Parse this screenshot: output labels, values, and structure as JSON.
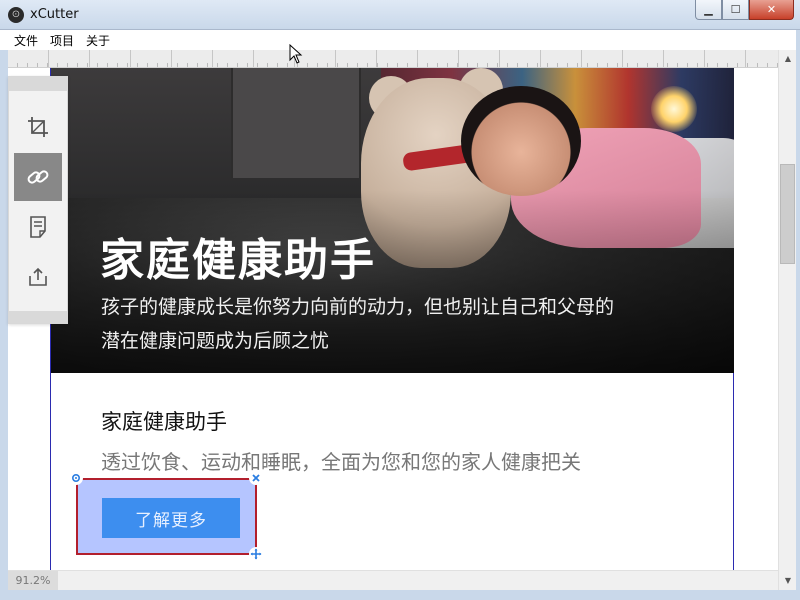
{
  "window": {
    "title": "xCutter",
    "app_icon_glyph": "⊙",
    "controls": {
      "minimize": "▁",
      "maximize": "☐",
      "close": "✕"
    }
  },
  "menu": {
    "items": [
      "文件",
      "项目",
      "关于"
    ]
  },
  "toolbar": {
    "tools": [
      {
        "icon": "crop-icon",
        "active": false
      },
      {
        "icon": "link-icon",
        "active": true
      },
      {
        "icon": "document-icon",
        "active": false
      },
      {
        "icon": "export-icon",
        "active": false
      }
    ]
  },
  "hero": {
    "title": "家庭健康助手",
    "subtitle": "孩子的健康成长是你努力向前的动力，但也别让自己和父母的潜在健康问题成为后顾之忧"
  },
  "section": {
    "title": "家庭健康助手",
    "subtitle": "透过饮食、运动和睡眠，全面为您和您的家人健康把关"
  },
  "cta": {
    "label": "了解更多"
  },
  "selection": {
    "settings_handle": "gear-icon",
    "close_handle": "close-icon",
    "move_handle": "move-icon"
  },
  "statusbar": {
    "zoom": "91.2%"
  },
  "colors": {
    "cta_bg": "#3d8eef",
    "selection_border": "#b21f2d",
    "selection_fill": "#7896ff",
    "page_border": "#2b2bb0"
  }
}
